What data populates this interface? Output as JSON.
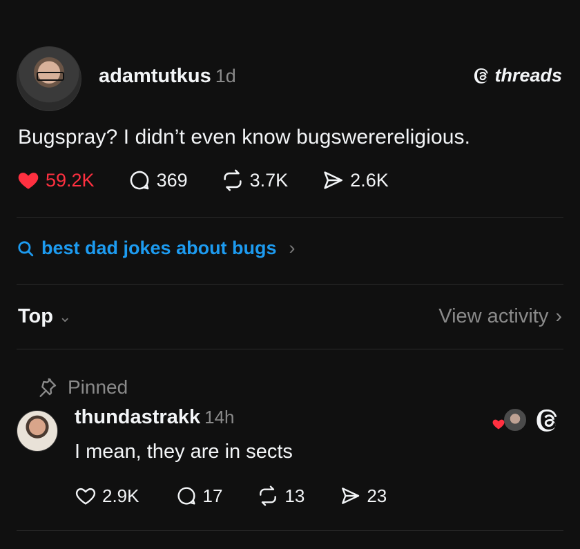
{
  "post": {
    "author": "adamtutkus",
    "time": "1d",
    "brand": "threads",
    "text": "Bugspray? I didn’t even know bugswerereligious.",
    "stats": {
      "likes": "59.2K",
      "replies": "369",
      "reposts": "3.7K",
      "shares": "2.6K"
    },
    "liked": true,
    "like_color": "#ff3040"
  },
  "search_suggestion": {
    "text": "best dad jokes about bugs",
    "chevron": "›",
    "color": "#1d9bf0"
  },
  "sort": {
    "label": "Top",
    "chevron": "⌄",
    "view_activity": "View activity",
    "view_chevron": "›"
  },
  "comment": {
    "pinned_label": "Pinned",
    "author": "thundastrakk",
    "time": "14h",
    "text": "I mean, they are in sects",
    "stats": {
      "likes": "2.9K",
      "replies": "17",
      "reposts": "13",
      "shares": "23"
    }
  },
  "icons": [
    "threads-logo-icon",
    "heart-icon",
    "comment-icon",
    "repost-icon",
    "share-icon",
    "search-icon",
    "pin-icon"
  ]
}
